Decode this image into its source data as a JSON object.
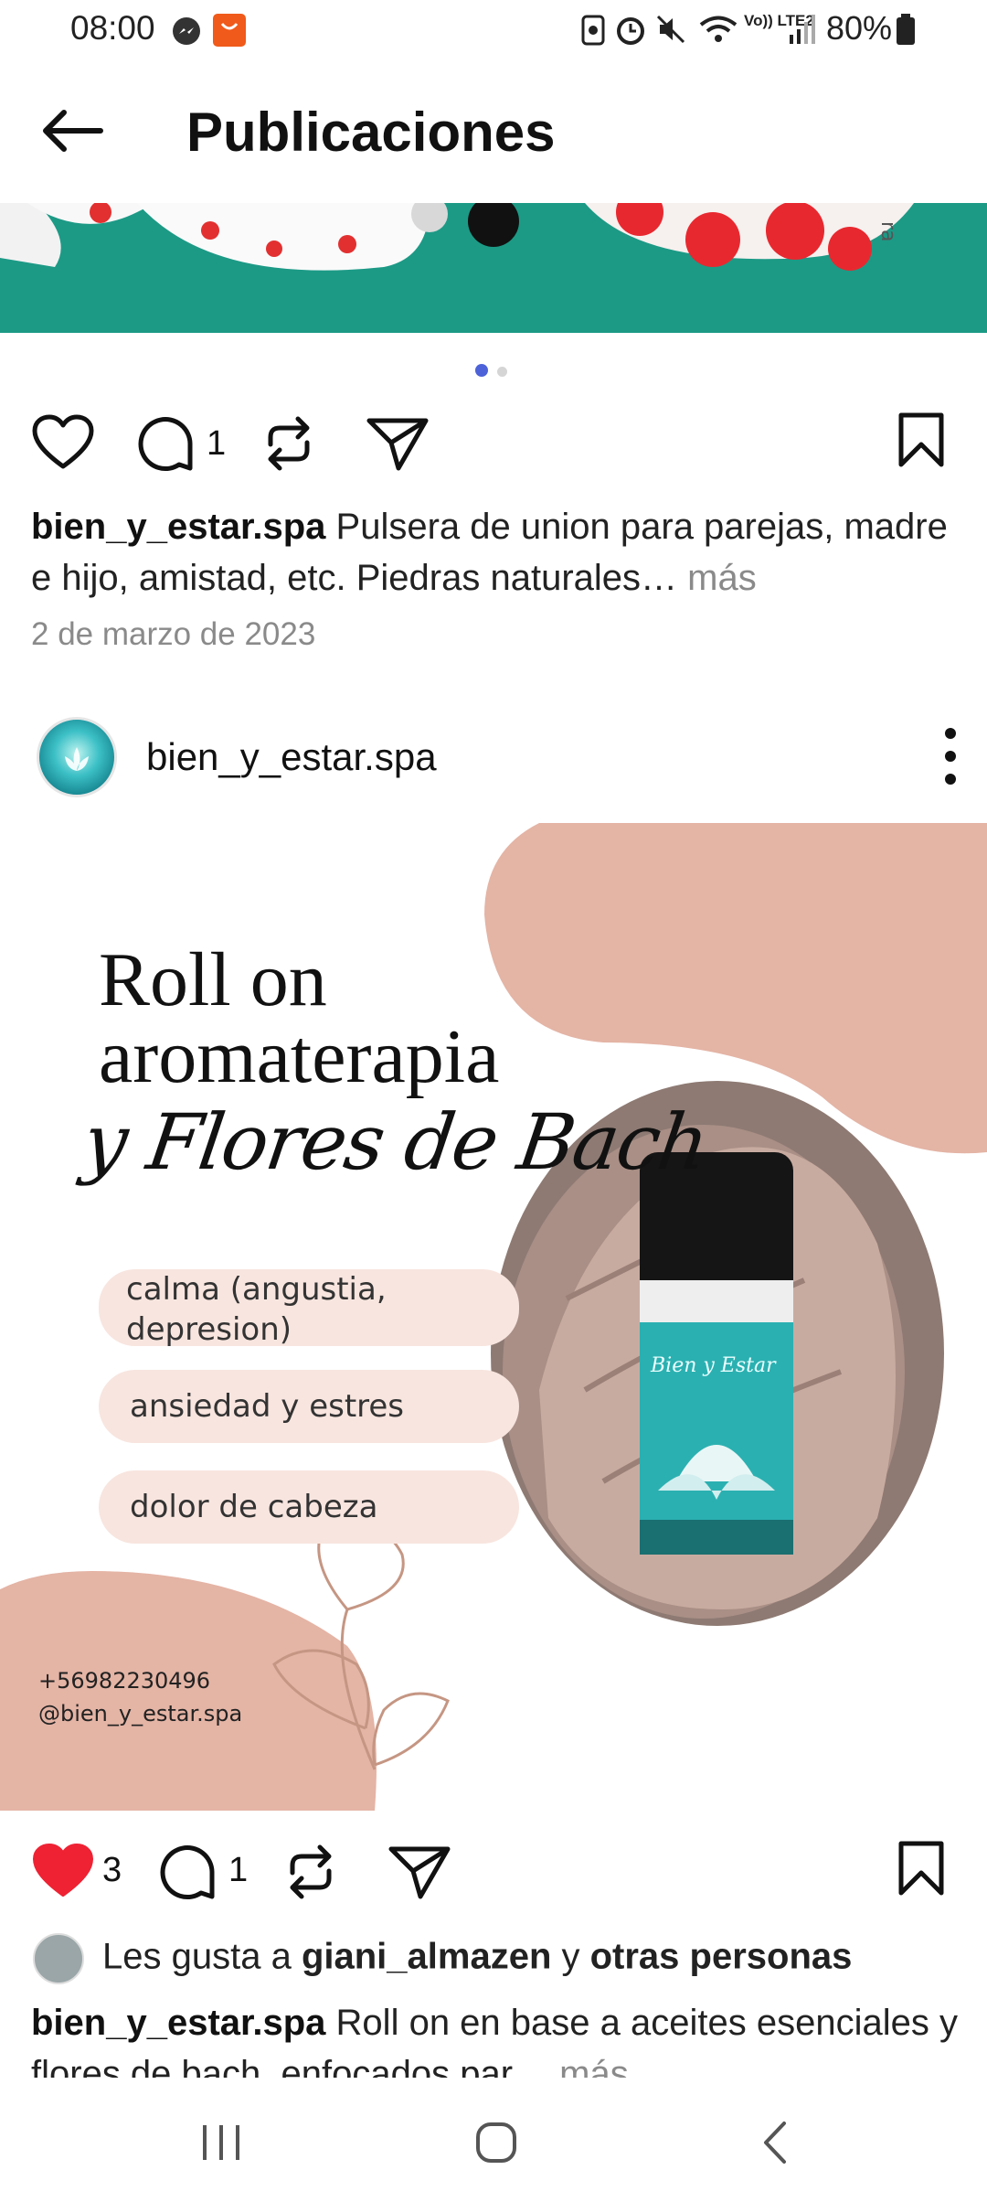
{
  "status_bar": {
    "time": "08:00",
    "battery": "80%",
    "network": "Vo)) LTE2",
    "icons": [
      "messenger-icon",
      "aliexpress-icon",
      "nfc-icon",
      "alarm-icon",
      "mute-icon",
      "wifi-icon",
      "signal-icon",
      "battery-icon"
    ]
  },
  "header": {
    "title": "Publicaciones",
    "back_icon": "arrow-left-icon"
  },
  "post1": {
    "comment_count": "1",
    "username": "bien_y_estar.spa",
    "caption": "Pulsera de union para parejas, madre e hijo, amistad, etc. Piedras naturales…",
    "more": "más",
    "date": "2 de marzo de 2023",
    "carousel_total": 2,
    "carousel_active": 0
  },
  "post2": {
    "username": "bien_y_estar.spa",
    "image": {
      "title_line1": "Roll on",
      "title_line2": "aromaterapia",
      "script_text": "y Flores de Bach",
      "pill1": "calma (angustia, depresion)",
      "pill2": "ansiedad y estres",
      "pill3": "dolor de cabeza",
      "phone": "+56982230496",
      "handle": "@bien_y_estar.spa"
    },
    "like_count": "3",
    "comment_count": "1",
    "likes_prefix": "Les gusta a ",
    "likes_user": "giani_almazen",
    "likes_middle": " y ",
    "likes_others": "otras personas",
    "caption_user": "bien_y_estar.spa",
    "caption": "Roll on en base a aceites esenciales y flores de bach, enfocados par…",
    "more": "más"
  },
  "colors": {
    "accent_dot": "#4d62d8",
    "like_red": "#ee2233",
    "pink_blob": "#e4b4a5",
    "pill_bg": "#f8e5df",
    "teal": "#1c9a86"
  },
  "nav_bar": [
    "recents-icon",
    "home-icon",
    "back-icon"
  ]
}
